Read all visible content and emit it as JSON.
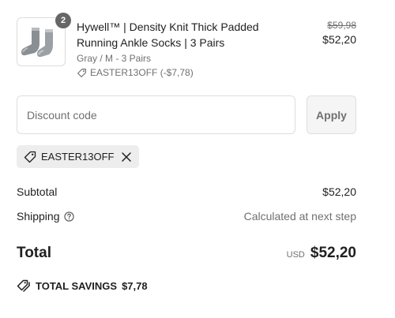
{
  "product": {
    "quantity": "2",
    "title": "Hywell™ | Density Knit Thick Padded Running Ankle Socks | 3 Pairs",
    "variant": "Gray / M - 3 Pairs",
    "discount_applied": "EASTER13OFF (-$7,78)",
    "original_price": "$59,98",
    "price": "$52,20",
    "image_icon": "socks-image"
  },
  "discount": {
    "placeholder": "Discount code",
    "apply_label": "Apply"
  },
  "applied_code": {
    "code": "EASTER13OFF",
    "icon": "tag-icon",
    "remove_icon": "close-icon"
  },
  "summary": {
    "subtotal_label": "Subtotal",
    "subtotal_value": "$52,20",
    "shipping_label": "Shipping",
    "shipping_value": "Calculated at next step",
    "total_label": "Total",
    "currency": "USD",
    "total_value": "$52,20"
  },
  "savings": {
    "label": "TOTAL SAVINGS",
    "value": "$7,78",
    "icon": "tags-icon"
  },
  "colors": {
    "text": "#1f1f1f",
    "muted": "#707070",
    "border": "#dedede",
    "chip_bg": "#ededed",
    "badge_bg": "#666666"
  }
}
